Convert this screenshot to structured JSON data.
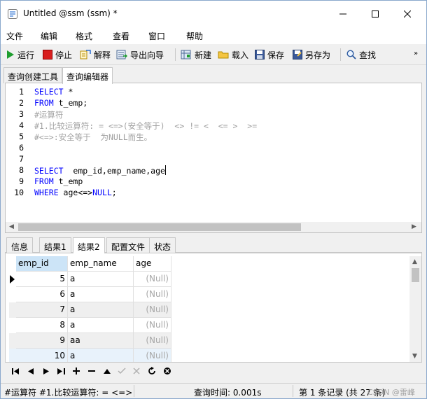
{
  "window": {
    "title": "Untitled @ssm (ssm) *"
  },
  "menu": [
    "文件",
    "编辑",
    "格式",
    "查看",
    "窗口",
    "帮助"
  ],
  "toolbar": {
    "run": "运行",
    "stop": "停止",
    "explain": "解释",
    "export_wizard": "导出向导",
    "new": "新建",
    "load": "载入",
    "save": "保存",
    "save_as": "另存为",
    "find": "查找"
  },
  "editor_tabs": [
    "查询创建工具",
    "查询编辑器"
  ],
  "editor": {
    "lines": [
      {
        "n": "1",
        "parts": [
          [
            "kw",
            "SELECT"
          ],
          [
            "t",
            " *"
          ]
        ]
      },
      {
        "n": "2",
        "parts": [
          [
            "kw",
            "FROM"
          ],
          [
            "t",
            " t_emp;"
          ]
        ]
      },
      {
        "n": "3",
        "parts": [
          [
            "cm",
            "#运算符"
          ]
        ]
      },
      {
        "n": "4",
        "parts": [
          [
            "cm",
            "#1.比较运算符: = <=>(安全等于)  <> != <  <= >  >="
          ]
        ]
      },
      {
        "n": "5",
        "parts": [
          [
            "cm",
            "#<=>:安全等于  为NULL而生。"
          ]
        ]
      },
      {
        "n": "6",
        "parts": []
      },
      {
        "n": "7",
        "parts": []
      },
      {
        "n": "8",
        "parts": [
          [
            "kw",
            "SELECT"
          ],
          [
            "t",
            "  emp_id,emp_name,age"
          ]
        ]
      },
      {
        "n": "9",
        "parts": [
          [
            "kw",
            "FROM"
          ],
          [
            "t",
            " t_emp"
          ]
        ]
      },
      {
        "n": "10",
        "parts": [
          [
            "kw",
            "WHERE"
          ],
          [
            "t",
            " age<=>"
          ],
          [
            "kw",
            "NULL"
          ],
          [
            "t",
            ";"
          ]
        ]
      }
    ]
  },
  "result_tabs": [
    "信息",
    "结果1",
    "结果2",
    "配置文件",
    "状态"
  ],
  "grid": {
    "columns": [
      "emp_id",
      "emp_name",
      "age"
    ],
    "rows": [
      [
        "5",
        "a",
        "(Null)"
      ],
      [
        "6",
        "a",
        "(Null)"
      ],
      [
        "7",
        "a",
        "(Null)"
      ],
      [
        "8",
        "a",
        "(Null)"
      ],
      [
        "9",
        "aa",
        "(Null)"
      ],
      [
        "10",
        "a",
        "(Null)"
      ]
    ]
  },
  "status": {
    "sql": "#运算符 #1.比较运算符: = <=>(",
    "query_time": "查询时间: 0.001s",
    "records": "第 1 条记录 (共 27 条)",
    "watermark": "CSDN @雷峰"
  }
}
